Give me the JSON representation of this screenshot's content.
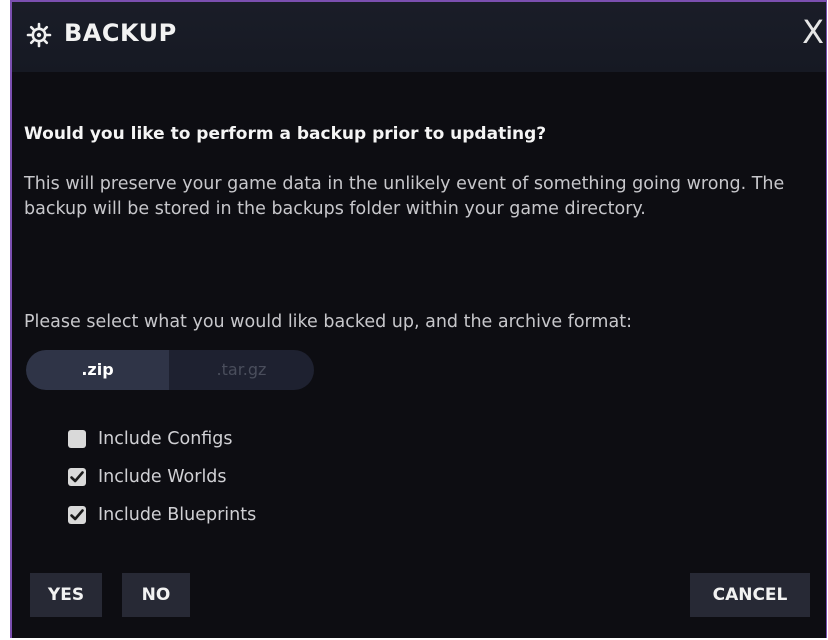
{
  "dialog": {
    "title": "BACKUP",
    "title_icon": "gear-icon",
    "close_label": "X"
  },
  "content": {
    "question": "Would you like to perform a backup prior to updating?",
    "description": "This will preserve your game data in the unlikely event of something going wrong. The backup will be stored in the backups folder within your game directory.",
    "select_prompt": "Please select what you would like backed up, and the archive format:"
  },
  "format": {
    "options": [
      ".zip",
      ".tar.gz"
    ],
    "selected": ".zip"
  },
  "options": [
    {
      "label": "Include Configs",
      "checked": false
    },
    {
      "label": "Include Worlds",
      "checked": true
    },
    {
      "label": "Include Blueprints",
      "checked": true
    }
  ],
  "buttons": {
    "yes": "YES",
    "no": "NO",
    "cancel": "CANCEL"
  }
}
